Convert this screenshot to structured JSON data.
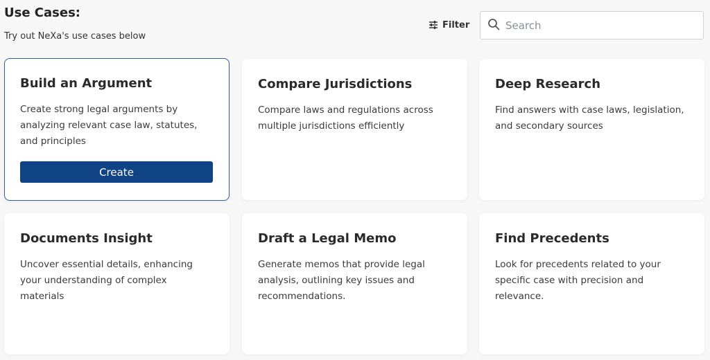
{
  "header": {
    "title": "Use Cases:",
    "subtitle": "Try out NeXa's use cases below"
  },
  "toolbar": {
    "filter_label": "Filter",
    "filter_icon": "sliders-icon",
    "search_icon": "search-icon",
    "search_placeholder": "Search",
    "search_value": ""
  },
  "colors": {
    "accent": "#0f4386",
    "selected_border": "#2d5e9e",
    "page_background": "#f7f7f8",
    "card_background": "#ffffff"
  },
  "cards": [
    {
      "title": "Build an Argument",
      "description": "Create strong legal arguments by analyzing relevant case law, statutes, and principles",
      "selected": true,
      "button_label": "Create"
    },
    {
      "title": "Compare Jurisdictions",
      "description": "Compare laws and regulations across multiple jurisdictions efficiently"
    },
    {
      "title": "Deep Research",
      "description": "Find answers with case laws, legislation, and secondary sources"
    },
    {
      "title": "Documents Insight",
      "description": "Uncover essential details, enhancing your understanding of complex materials"
    },
    {
      "title": "Draft a Legal Memo",
      "description": "Generate memos that provide legal analysis, outlining key issues and recommendations."
    },
    {
      "title": "Find Precedents",
      "description": "Look for precedents related to your specific case with precision and relevance."
    }
  ]
}
